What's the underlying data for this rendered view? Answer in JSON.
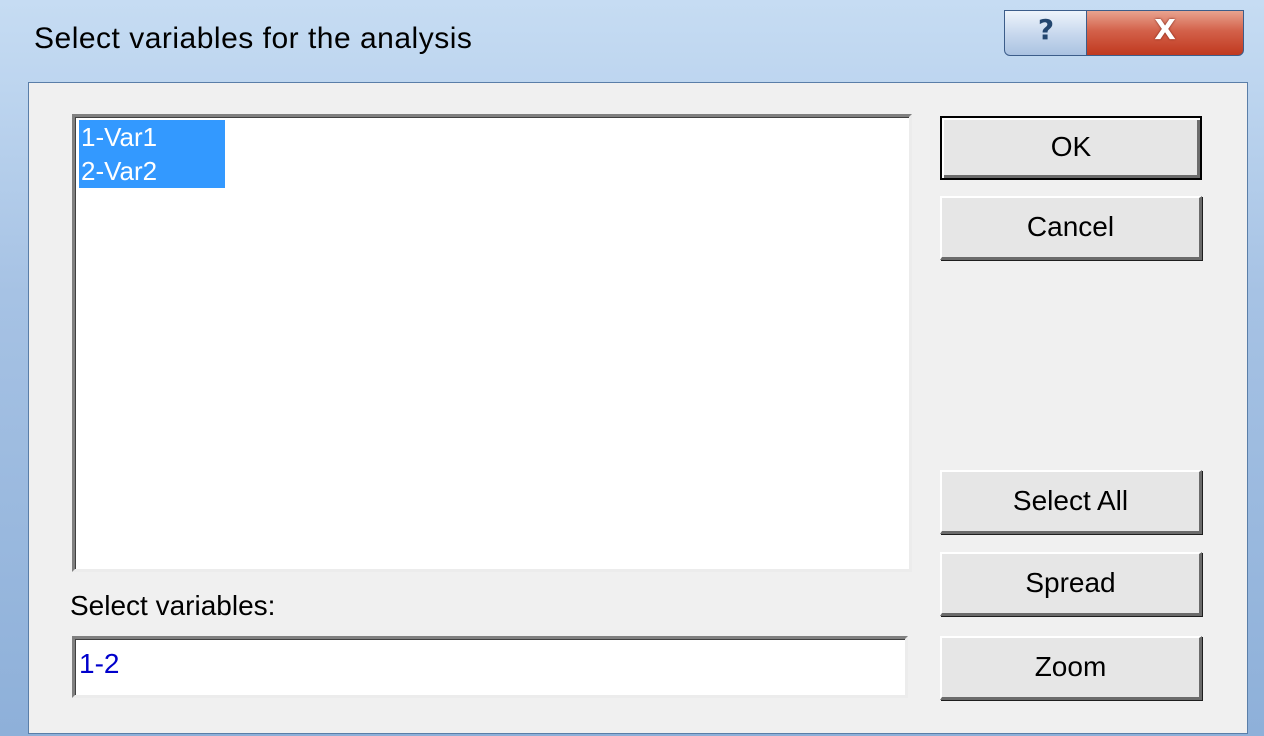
{
  "window": {
    "title": "Select variables for the analysis",
    "help_glyph": "?",
    "close_glyph": "X"
  },
  "variables_list": {
    "items": [
      {
        "label": "1-Var1",
        "selected": true
      },
      {
        "label": "2-Var2",
        "selected": true
      }
    ]
  },
  "buttons": {
    "ok": "OK",
    "cancel": "Cancel",
    "select_all": "Select All",
    "spread": "Spread",
    "zoom": "Zoom"
  },
  "selection": {
    "label": "Select variables:",
    "value": "1-2"
  },
  "colors": {
    "selection_highlight": "#3399ff",
    "input_text": "#0000cc"
  }
}
